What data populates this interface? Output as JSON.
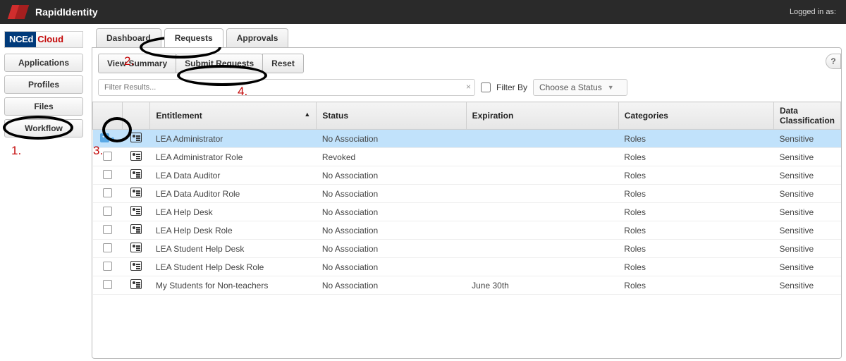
{
  "app": {
    "brand": "RapidIdentity",
    "logged_in_label": "Logged in as:"
  },
  "sidebar": {
    "logo_left": "NCEd",
    "logo_right": "Cloud",
    "buttons": [
      "Applications",
      "Profiles",
      "Files",
      "Workflow"
    ]
  },
  "tabs": {
    "items": [
      "Dashboard",
      "Requests",
      "Approvals"
    ],
    "active_index": 1
  },
  "toolbar": {
    "view_summary": "View Summary",
    "submit_requests": "Submit Requests",
    "reset": "Reset"
  },
  "filter": {
    "placeholder": "Filter Results...",
    "clear_symbol": "×",
    "filter_by_label": "Filter By",
    "status_select": "Choose a Status"
  },
  "table": {
    "headers": {
      "entitlement": "Entitlement",
      "status": "Status",
      "expiration": "Expiration",
      "categories": "Categories",
      "data_classification": "Data Classification"
    },
    "rows": [
      {
        "checked": true,
        "name": "LEA Administrator",
        "status": "No Association",
        "status_red": false,
        "expiration": "",
        "categories": "Roles",
        "dc": "Sensitive"
      },
      {
        "checked": false,
        "name": "LEA Administrator Role",
        "status": "Revoked",
        "status_red": true,
        "expiration": "",
        "categories": "Roles",
        "dc": "Sensitive"
      },
      {
        "checked": false,
        "name": "LEA Data Auditor",
        "status": "No Association",
        "status_red": false,
        "expiration": "",
        "categories": "Roles",
        "dc": "Sensitive"
      },
      {
        "checked": false,
        "name": "LEA Data Auditor Role",
        "status": "No Association",
        "status_red": false,
        "expiration": "",
        "categories": "Roles",
        "dc": "Sensitive"
      },
      {
        "checked": false,
        "name": "LEA Help Desk",
        "status": "No Association",
        "status_red": false,
        "expiration": "",
        "categories": "Roles",
        "dc": "Sensitive"
      },
      {
        "checked": false,
        "name": "LEA Help Desk Role",
        "status": "No Association",
        "status_red": false,
        "expiration": "",
        "categories": "Roles",
        "dc": "Sensitive"
      },
      {
        "checked": false,
        "name": "LEA Student Help Desk",
        "status": "No Association",
        "status_red": false,
        "expiration": "",
        "categories": "Roles",
        "dc": "Sensitive"
      },
      {
        "checked": false,
        "name": "LEA Student Help Desk Role",
        "status": "No Association",
        "status_red": false,
        "expiration": "",
        "categories": "Roles",
        "dc": "Sensitive"
      },
      {
        "checked": false,
        "name": "My Students for Non-teachers",
        "status": "No Association",
        "status_red": false,
        "expiration": "June 30th",
        "categories": "Roles",
        "dc": "Sensitive"
      }
    ]
  },
  "annotations": {
    "n1": "1.",
    "n2": "2.",
    "n3": "3.",
    "n4": "4."
  },
  "help_symbol": "?"
}
